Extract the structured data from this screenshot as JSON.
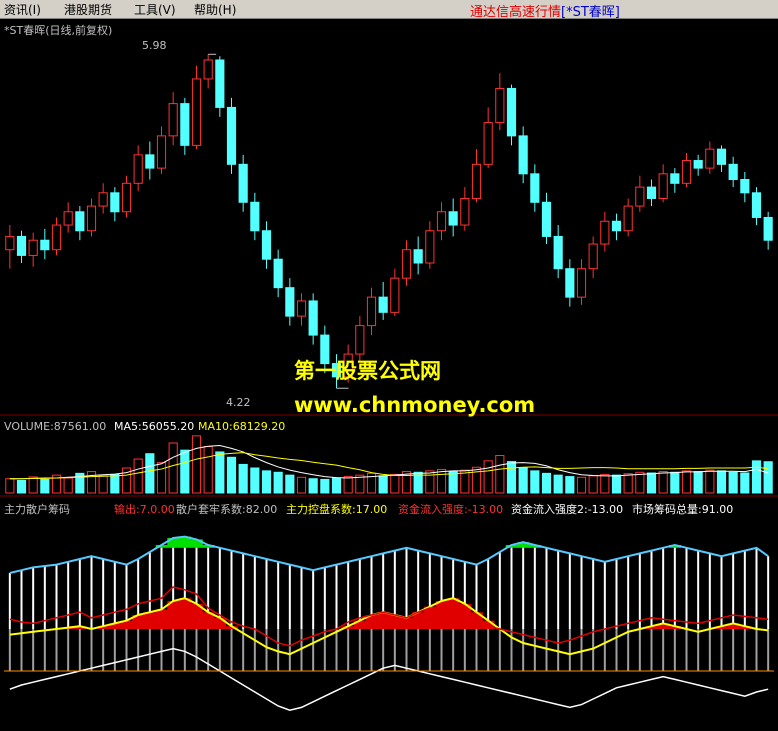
{
  "menu": [
    {
      "label": "资讯(I)"
    },
    {
      "label": "港股期货"
    },
    {
      "label": "工具(V)"
    },
    {
      "label": "帮助(H)"
    }
  ],
  "app_title": {
    "prefix": "通达信高速行情",
    "stock": "[*ST春晖]"
  },
  "price_panel": {
    "title": "*ST春晖(日线,前复权)",
    "high_label": "5.98",
    "low_label": "4.22"
  },
  "volume_panel": {
    "volume": "VOLUME:87561.00",
    "ma5": "MA5:56055.20",
    "ma10": "MA10:68129.20"
  },
  "indicator_panel": {
    "name": "主力散户筹码",
    "output": "输出:7.0.00",
    "retail_trap": "散户套牢系数:82.00",
    "main_control": "主力控盘系数:17.00",
    "inflow": "资金流入强度:-13.00",
    "inflow2": "资金流入强度2:-13.00",
    "total_chips": "市场筹码总量:91.00"
  },
  "watermark": {
    "line1": "第一股票公式网",
    "line2": "www.chnmoney.com"
  },
  "colors": {
    "up": "#ff3232",
    "down": "#54ffff",
    "ma5": "#ffffff",
    "ma10": "#ffff00",
    "text_yellow": "#ffff00",
    "text_red": "#ff3232"
  },
  "chart_data": [
    {
      "type": "candlestick",
      "title": "*ST春晖(日线,前复权)",
      "ylim": [
        4.1,
        6.05
      ],
      "annotations": [
        {
          "label": "5.98"
        },
        {
          "label": "4.22"
        }
      ],
      "candles": [
        [
          4.95,
          5.02,
          5.08,
          4.85
        ],
        [
          5.02,
          4.92,
          5.05,
          4.88
        ],
        [
          4.92,
          5.0,
          5.04,
          4.86
        ],
        [
          5.0,
          4.95,
          5.06,
          4.9
        ],
        [
          4.95,
          5.08,
          5.12,
          4.92
        ],
        [
          5.08,
          5.15,
          5.2,
          5.04
        ],
        [
          5.15,
          5.05,
          5.18,
          5.0
        ],
        [
          5.05,
          5.18,
          5.22,
          5.02
        ],
        [
          5.18,
          5.25,
          5.3,
          5.14
        ],
        [
          5.25,
          5.15,
          5.28,
          5.1
        ],
        [
          5.15,
          5.3,
          5.34,
          5.12
        ],
        [
          5.3,
          5.45,
          5.5,
          5.26
        ],
        [
          5.45,
          5.38,
          5.52,
          5.32
        ],
        [
          5.38,
          5.55,
          5.6,
          5.35
        ],
        [
          5.55,
          5.72,
          5.78,
          5.5
        ],
        [
          5.72,
          5.5,
          5.75,
          5.45
        ],
        [
          5.5,
          5.85,
          5.92,
          5.48
        ],
        [
          5.85,
          5.95,
          5.98,
          5.8
        ],
        [
          5.95,
          5.7,
          5.97,
          5.65
        ],
        [
          5.7,
          5.4,
          5.75,
          5.35
        ],
        [
          5.4,
          5.2,
          5.45,
          5.15
        ],
        [
          5.2,
          5.05,
          5.25,
          5.0
        ],
        [
          5.05,
          4.9,
          5.1,
          4.85
        ],
        [
          4.9,
          4.75,
          4.95,
          4.7
        ],
        [
          4.75,
          4.6,
          4.8,
          4.55
        ],
        [
          4.6,
          4.68,
          4.72,
          4.55
        ],
        [
          4.68,
          4.5,
          4.72,
          4.45
        ],
        [
          4.5,
          4.35,
          4.55,
          4.3
        ],
        [
          4.35,
          4.28,
          4.4,
          4.22
        ],
        [
          4.28,
          4.4,
          4.45,
          4.25
        ],
        [
          4.4,
          4.55,
          4.6,
          4.36
        ],
        [
          4.55,
          4.7,
          4.75,
          4.5
        ],
        [
          4.7,
          4.62,
          4.78,
          4.58
        ],
        [
          4.62,
          4.8,
          4.85,
          4.6
        ],
        [
          4.8,
          4.95,
          5.0,
          4.76
        ],
        [
          4.95,
          4.88,
          5.02,
          4.82
        ],
        [
          4.88,
          5.05,
          5.1,
          4.85
        ],
        [
          5.05,
          5.15,
          5.2,
          5.0
        ],
        [
          5.15,
          5.08,
          5.22,
          5.02
        ],
        [
          5.08,
          5.22,
          5.28,
          5.05
        ],
        [
          5.22,
          5.4,
          5.48,
          5.2
        ],
        [
          5.4,
          5.62,
          5.7,
          5.38
        ],
        [
          5.62,
          5.8,
          5.88,
          5.58
        ],
        [
          5.8,
          5.55,
          5.82,
          5.5
        ],
        [
          5.55,
          5.35,
          5.6,
          5.3
        ],
        [
          5.35,
          5.2,
          5.4,
          5.15
        ],
        [
          5.2,
          5.02,
          5.25,
          4.98
        ],
        [
          5.02,
          4.85,
          5.08,
          4.8
        ],
        [
          4.85,
          4.7,
          4.9,
          4.65
        ],
        [
          4.7,
          4.85,
          4.9,
          4.66
        ],
        [
          4.85,
          4.98,
          5.02,
          4.8
        ],
        [
          4.98,
          5.1,
          5.15,
          4.94
        ],
        [
          5.1,
          5.05,
          5.14,
          5.0
        ],
        [
          5.05,
          5.18,
          5.22,
          5.02
        ],
        [
          5.18,
          5.28,
          5.34,
          5.15
        ],
        [
          5.28,
          5.22,
          5.32,
          5.18
        ],
        [
          5.22,
          5.35,
          5.4,
          5.2
        ],
        [
          5.35,
          5.3,
          5.38,
          5.25
        ],
        [
          5.3,
          5.42,
          5.46,
          5.28
        ],
        [
          5.42,
          5.38,
          5.45,
          5.34
        ],
        [
          5.38,
          5.48,
          5.52,
          5.35
        ],
        [
          5.48,
          5.4,
          5.5,
          5.36
        ],
        [
          5.4,
          5.32,
          5.44,
          5.28
        ],
        [
          5.32,
          5.25,
          5.36,
          5.2
        ],
        [
          5.25,
          5.12,
          5.28,
          5.08
        ],
        [
          5.12,
          5.0,
          5.15,
          4.95
        ]
      ]
    },
    {
      "type": "bar",
      "title": "VOLUME",
      "series": [
        {
          "name": "VOLUME",
          "values": [
            40,
            35,
            45,
            38,
            50,
            42,
            55,
            60,
            48,
            52,
            70,
            95,
            110,
            85,
            140,
            120,
            160,
            130,
            115,
            100,
            80,
            70,
            62,
            58,
            50,
            44,
            40,
            38,
            42,
            46,
            50,
            55,
            48,
            52,
            60,
            58,
            62,
            66,
            60,
            64,
            72,
            90,
            105,
            88,
            70,
            62,
            55,
            50,
            46,
            44,
            48,
            52,
            50,
            54,
            58,
            56,
            60,
            58,
            62,
            60,
            64,
            62,
            58,
            56,
            90,
            87.56
          ]
        },
        {
          "name": "MA5",
          "values": [
            40,
            40,
            41,
            42,
            42,
            44,
            46,
            49,
            51,
            53,
            57,
            67,
            75,
            82,
            100,
            114,
            125,
            131,
            133,
            125,
            115,
            99,
            85,
            73,
            64,
            57,
            51,
            46,
            43,
            42,
            44,
            46,
            48,
            50,
            53,
            55,
            56,
            60,
            62,
            62,
            65,
            70,
            78,
            84,
            85,
            83,
            76,
            65,
            57,
            51,
            49,
            48,
            48,
            50,
            52,
            54,
            56,
            57,
            59,
            59,
            61,
            61,
            61,
            60,
            66,
            56.06
          ]
        },
        {
          "name": "MA10",
          "values": [
            40,
            40,
            41,
            41,
            42,
            43,
            44,
            46,
            47,
            48,
            50,
            56,
            62,
            67,
            77,
            85,
            95,
            101,
            108,
            111,
            113,
            107,
            103,
            98,
            94,
            91,
            86,
            82,
            78,
            71,
            65,
            57,
            52,
            49,
            49,
            50,
            50,
            52,
            54,
            56,
            59,
            62,
            67,
            70,
            72,
            73,
            71,
            69,
            69,
            70,
            71,
            71,
            70,
            68,
            68,
            68,
            68,
            68,
            69,
            69,
            70,
            70,
            70,
            70,
            72,
            68.13
          ]
        }
      ]
    },
    {
      "type": "area",
      "title": "主力散户筹码",
      "ylim": [
        -40,
        110
      ],
      "series": [
        {
          "name": "输出",
          "values": [
            7,
            5,
            4,
            6,
            8,
            10,
            12,
            8,
            10,
            12,
            14,
            18,
            20,
            22,
            30,
            28,
            25,
            15,
            10,
            5,
            2,
            0,
            -5,
            -10,
            -12,
            -8,
            -5,
            -2,
            0,
            5,
            8,
            10,
            12,
            10,
            8,
            12,
            15,
            10,
            8,
            6,
            4,
            2,
            0,
            -2,
            -4,
            -6,
            -8,
            -10,
            -8,
            -5,
            -2,
            0,
            2,
            4,
            6,
            8,
            7,
            6,
            5,
            4,
            6,
            8,
            10,
            9,
            8,
            7
          ]
        },
        {
          "name": "散户套牢系数",
          "values": [
            70,
            72,
            74,
            75,
            76,
            78,
            80,
            82,
            80,
            78,
            76,
            80,
            85,
            90,
            95,
            96,
            94,
            90,
            88,
            86,
            84,
            82,
            80,
            78,
            76,
            74,
            72,
            74,
            76,
            78,
            80,
            82,
            84,
            86,
            88,
            86,
            84,
            82,
            80,
            78,
            76,
            80,
            85,
            90,
            92,
            90,
            88,
            86,
            84,
            82,
            80,
            78,
            80,
            82,
            84,
            86,
            88,
            90,
            88,
            86,
            84,
            82,
            84,
            86,
            88,
            82
          ]
        },
        {
          "name": "主力控盘系数",
          "values": [
            14,
            15,
            16,
            17,
            18,
            19,
            20,
            18,
            20,
            22,
            24,
            28,
            30,
            32,
            38,
            40,
            36,
            30,
            26,
            20,
            15,
            10,
            5,
            2,
            0,
            4,
            8,
            12,
            16,
            20,
            24,
            28,
            30,
            28,
            26,
            30,
            34,
            38,
            40,
            36,
            30,
            24,
            18,
            12,
            8,
            6,
            4,
            2,
            0,
            2,
            4,
            8,
            12,
            16,
            18,
            20,
            22,
            20,
            18,
            16,
            18,
            20,
            22,
            20,
            18,
            17
          ]
        },
        {
          "name": "资金流入强度",
          "values": [
            -13,
            -10,
            -8,
            -6,
            -4,
            -2,
            0,
            2,
            4,
            6,
            8,
            10,
            12,
            14,
            16,
            14,
            10,
            5,
            0,
            -5,
            -10,
            -15,
            -20,
            -25,
            -28,
            -26,
            -22,
            -18,
            -14,
            -10,
            -6,
            -2,
            2,
            4,
            2,
            0,
            -2,
            -4,
            -6,
            -8,
            -10,
            -12,
            -14,
            -16,
            -18,
            -20,
            -22,
            -24,
            -26,
            -24,
            -20,
            -16,
            -12,
            -10,
            -8,
            -6,
            -4,
            -6,
            -8,
            -10,
            -12,
            -14,
            -16,
            -18,
            -15,
            -13
          ]
        },
        {
          "name": "市场筹码总量",
          "values": [
            88,
            88,
            89,
            89,
            90,
            90,
            90,
            91,
            91,
            91,
            91,
            90,
            90,
            90,
            89,
            89,
            90,
            90,
            91,
            91,
            91,
            91,
            90,
            90,
            90,
            90,
            91,
            91,
            91,
            91,
            91,
            90,
            90,
            90,
            90,
            90,
            91,
            91,
            91,
            91,
            91,
            91,
            90,
            90,
            90,
            90,
            90,
            90,
            91,
            91,
            91,
            91,
            91,
            91,
            91,
            91,
            91,
            91,
            91,
            91,
            91,
            91,
            91,
            91,
            91,
            91
          ]
        }
      ]
    }
  ]
}
